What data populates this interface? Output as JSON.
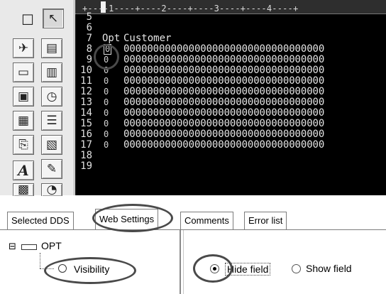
{
  "ruler": {
    "text": "+----1----+----2----+----3----+----4----+"
  },
  "editor": {
    "header_opt": "Opt",
    "header_customer": "Customer",
    "rows": [
      {
        "num": "5",
        "opt": "",
        "data": ""
      },
      {
        "num": "6",
        "opt": "",
        "data": ""
      },
      {
        "num": "7",
        "opt": "",
        "data": ""
      },
      {
        "num": "8",
        "opt": "0",
        "data": "0000000000000000000000000000000000"
      },
      {
        "num": "9",
        "opt": "0",
        "data": "0000000000000000000000000000000000"
      },
      {
        "num": "10",
        "opt": "0",
        "data": "0000000000000000000000000000000000"
      },
      {
        "num": "11",
        "opt": "0",
        "data": "0000000000000000000000000000000000"
      },
      {
        "num": "12",
        "opt": "0",
        "data": "0000000000000000000000000000000000"
      },
      {
        "num": "13",
        "opt": "0",
        "data": "0000000000000000000000000000000000"
      },
      {
        "num": "14",
        "opt": "0",
        "data": "0000000000000000000000000000000000"
      },
      {
        "num": "15",
        "opt": "0",
        "data": "0000000000000000000000000000000000"
      },
      {
        "num": "16",
        "opt": "0",
        "data": "0000000000000000000000000000000000"
      },
      {
        "num": "17",
        "opt": "0",
        "data": "0000000000000000000000000000000000"
      },
      {
        "num": "18",
        "opt": "",
        "data": ""
      },
      {
        "num": "19",
        "opt": "",
        "data": ""
      }
    ]
  },
  "palette": {
    "tools": [
      {
        "name": "checkbox-tool-icon",
        "glyph": "☐"
      },
      {
        "name": "pointer-tool-icon",
        "glyph": "↖"
      },
      {
        "name": "satellite-tool-icon",
        "glyph": "✈"
      },
      {
        "name": "record-tool-icon",
        "glyph": "▤"
      },
      {
        "name": "button-tool-icon",
        "glyph": "▭"
      },
      {
        "name": "field-tool-icon",
        "glyph": "▥"
      },
      {
        "name": "subfile-tool-icon",
        "glyph": "▣"
      },
      {
        "name": "clock-tool-icon",
        "glyph": "◷"
      },
      {
        "name": "window-tool-icon",
        "glyph": "▦"
      },
      {
        "name": "list-tool-icon",
        "glyph": "☰"
      },
      {
        "name": "page-tool-icon",
        "glyph": "⎘"
      },
      {
        "name": "script-tool-icon",
        "glyph": "▧"
      },
      {
        "name": "text-tool-icon",
        "glyph": "A"
      },
      {
        "name": "edit-tool-icon",
        "glyph": "✎"
      },
      {
        "name": "grid-tool-icon",
        "glyph": "▩"
      },
      {
        "name": "timer-tool-icon",
        "glyph": "◔"
      }
    ]
  },
  "tabs": {
    "selected_dds": "Selected DDS",
    "web_settings": "Web Settings",
    "comments": "Comments",
    "error_list": "Error list"
  },
  "tree": {
    "expand_glyph": "⊟",
    "root_label": "OPT",
    "child_label": "Visibility"
  },
  "properties": {
    "hide_field": "Hide field",
    "show_field": "Show field",
    "selected": "hide_field"
  }
}
